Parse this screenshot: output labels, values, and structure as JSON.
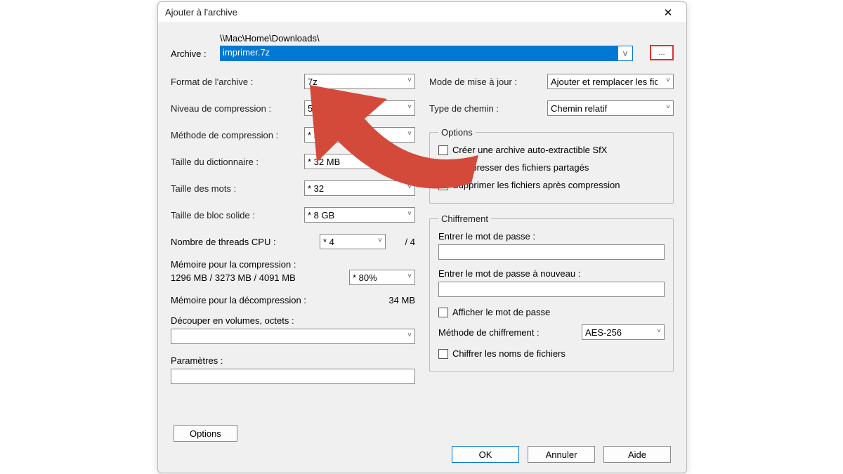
{
  "title": "Ajouter à l'archive",
  "archive": {
    "label": "Archive :",
    "path": "\\\\Mac\\Home\\Downloads\\",
    "filename": "imprimer.7z",
    "browse": "..."
  },
  "left": {
    "format": {
      "label": "Format de l'archive :",
      "value": "7z"
    },
    "level": {
      "label": "Niveau de compression :",
      "value": "5"
    },
    "method": {
      "label": "Méthode de compression :",
      "value": "* LZM"
    },
    "dict": {
      "label": "Taille du dictionnaire :",
      "value": "* 32 MB"
    },
    "word": {
      "label": "Taille des mots :",
      "value": "* 32"
    },
    "block": {
      "label": "Taille de bloc solide :",
      "value": "* 8 GB"
    },
    "threads": {
      "label": "Nombre de threads CPU :",
      "value": "* 4",
      "total": "/ 4"
    },
    "mem_comp": {
      "label": "Mémoire pour la compression :",
      "nums": "1296 MB / 3273 MB / 4091 MB",
      "pct": "* 80%"
    },
    "mem_decomp": {
      "label": "Mémoire pour la décompression :",
      "value": "34 MB"
    },
    "split": {
      "label": "Découper en volumes, octets :"
    },
    "params": {
      "label": "Paramètres :"
    }
  },
  "right": {
    "update": {
      "label": "Mode de mise à jour :",
      "value": "Ajouter et remplacer les fich"
    },
    "pathmode": {
      "label": "Type de chemin :",
      "value": "Chemin relatif"
    },
    "options": {
      "legend": "Options",
      "sfx": "Créer une archive auto-extractible SfX",
      "shared": "Compresser des fichiers partagés",
      "delete": "Supprimer les fichiers après compression"
    },
    "enc": {
      "legend": "Chiffrement",
      "pwd": "Entrer le mot de passe :",
      "pwd2": "Entrer le mot de passe à nouveau :",
      "show": "Afficher le mot de passe",
      "method_label": "Méthode de chiffrement :",
      "method_value": "AES-256",
      "names": "Chiffrer les noms de fichiers"
    }
  },
  "buttons": {
    "options": "Options",
    "ok": "OK",
    "cancel": "Annuler",
    "help": "Aide"
  }
}
